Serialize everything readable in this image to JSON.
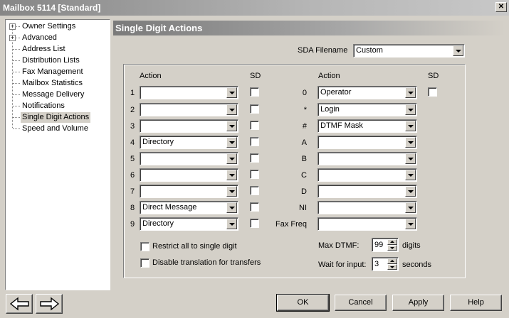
{
  "window": {
    "title": "Mailbox 5114 [Standard]",
    "close_glyph": "✕"
  },
  "tree": {
    "items": [
      {
        "label": "Owner Settings",
        "expandable": true,
        "glyph": "+"
      },
      {
        "label": "Advanced",
        "expandable": true,
        "glyph": "+"
      },
      {
        "label": "Address List"
      },
      {
        "label": "Distribution Lists"
      },
      {
        "label": "Fax Management"
      },
      {
        "label": "Mailbox Statistics"
      },
      {
        "label": "Message Delivery"
      },
      {
        "label": "Notifications"
      },
      {
        "label": "Single Digit Actions",
        "selected": true
      },
      {
        "label": "Speed and Volume"
      }
    ]
  },
  "panel": {
    "title": "Single Digit Actions",
    "sda_filename_label": "SDA Filename",
    "sda_filename_value": "Custom",
    "left_header_action": "Action",
    "left_header_sd": "SD",
    "right_header_action": "Action",
    "right_header_sd": "SD",
    "left_rows": [
      {
        "key": "1",
        "value": ""
      },
      {
        "key": "2",
        "value": ""
      },
      {
        "key": "3",
        "value": ""
      },
      {
        "key": "4",
        "value": "Directory"
      },
      {
        "key": "5",
        "value": ""
      },
      {
        "key": "6",
        "value": ""
      },
      {
        "key": "7",
        "value": ""
      },
      {
        "key": "8",
        "value": "Direct Message"
      },
      {
        "key": "9",
        "value": "Directory"
      }
    ],
    "right_rows": [
      {
        "key": "0",
        "value": "Operator",
        "has_sd": true
      },
      {
        "key": "*",
        "value": "Login"
      },
      {
        "key": "#",
        "value": "DTMF Mask"
      },
      {
        "key": "A",
        "value": ""
      },
      {
        "key": "B",
        "value": ""
      },
      {
        "key": "C",
        "value": ""
      },
      {
        "key": "D",
        "value": ""
      },
      {
        "key": "NI",
        "value": ""
      },
      {
        "key": "Fax Freq",
        "value": ""
      }
    ],
    "restrict_label": "Restrict all to single digit",
    "disable_translation_label": "Disable translation for transfers",
    "max_dtmf_label": "Max DTMF:",
    "max_dtmf_value": "99",
    "max_dtmf_unit": "digits",
    "wait_label": "Wait for input:",
    "wait_value": "3",
    "wait_unit": "seconds"
  },
  "buttons": {
    "ok": "OK",
    "cancel": "Cancel",
    "apply": "Apply",
    "help": "Help"
  },
  "icons": {
    "back": "arrow-left-icon",
    "forward": "arrow-right-icon"
  }
}
